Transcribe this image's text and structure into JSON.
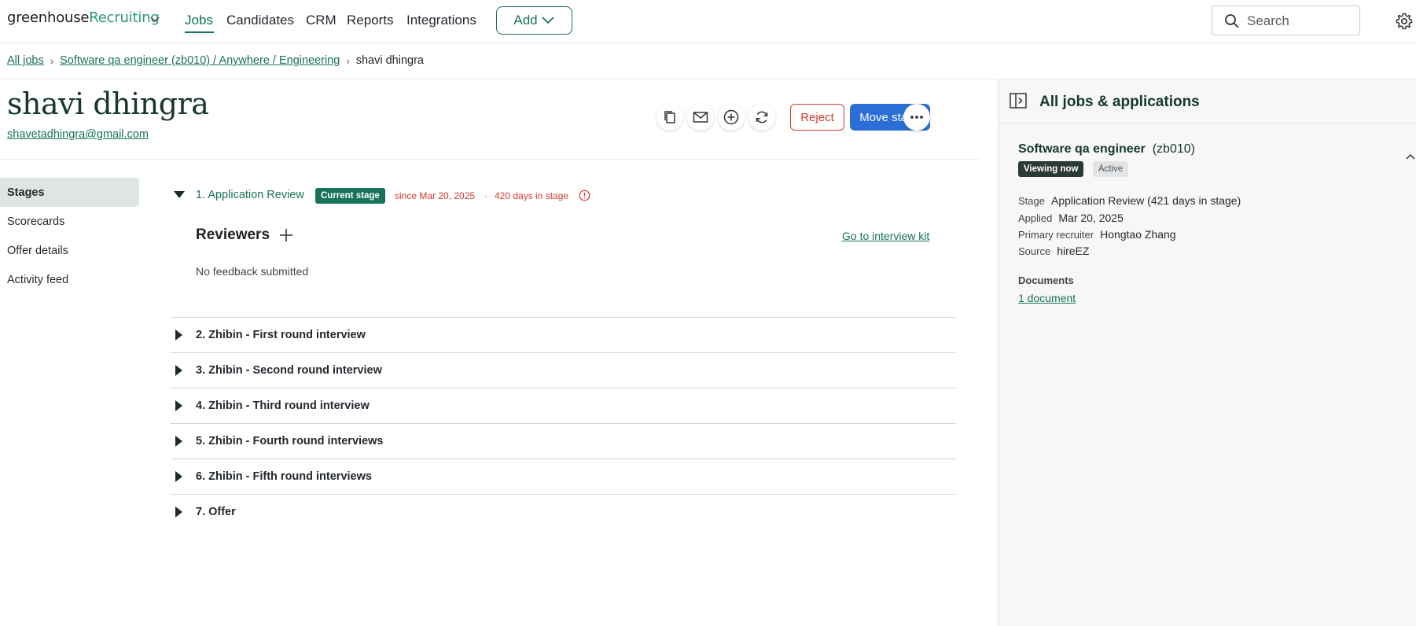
{
  "brand": {
    "name_part1": "greenhouse",
    "name_part2": "Recruiting"
  },
  "nav": {
    "items": [
      {
        "label": "Jobs",
        "active": true
      },
      {
        "label": "Candidates"
      },
      {
        "label": "CRM"
      },
      {
        "label": "Reports"
      },
      {
        "label": "Integrations"
      }
    ],
    "add_label": "Add",
    "search_placeholder": "Search"
  },
  "breadcrumb": {
    "all_jobs": "All jobs",
    "job": "Software qa engineer (zb010) / Anywhere / Engineering",
    "current": "shavi dhingra"
  },
  "candidate": {
    "name": "shavi dhingra",
    "email": "shavetadhingra@gmail.com"
  },
  "actions": {
    "reject": "Reject",
    "move_stage": "Move stage"
  },
  "tabs": [
    {
      "label": "Stages",
      "active": true
    },
    {
      "label": "Scorecards"
    },
    {
      "label": "Offer details"
    },
    {
      "label": "Activity feed"
    }
  ],
  "stage_current": {
    "title": "1. Application Review",
    "badge": "Current stage",
    "since": "since Mar 20, 2025",
    "sep": "·",
    "days": "420 days in stage",
    "reviewers_label": "Reviewers",
    "kit_link": "Go to interview kit",
    "no_feedback": "No feedback submitted"
  },
  "stages": [
    {
      "label": "2. Zhibin - First round interview"
    },
    {
      "label": "3. Zhibin - Second round interview"
    },
    {
      "label": "4. Zhibin - Third round interview"
    },
    {
      "label": "5. Zhibin - Fourth round interviews"
    },
    {
      "label": "6. Zhibin - Fifth round interviews"
    },
    {
      "label": "7. Offer"
    }
  ],
  "panel": {
    "title": "All jobs & applications",
    "job_name": "Software qa engineer",
    "job_code": "(zb010)",
    "badge_viewing": "Viewing now",
    "badge_status": "Active",
    "details": [
      {
        "key": "Stage",
        "value": "Application Review (421 days in stage)"
      },
      {
        "key": "Applied",
        "value": "Mar 20, 2025"
      },
      {
        "key": "Primary recruiter",
        "value": "Hongtao Zhang"
      },
      {
        "key": "Source",
        "value": "hireEZ"
      }
    ],
    "documents_label": "Documents",
    "documents_link": "1 document"
  },
  "colors": {
    "brand_green": "#17725a",
    "primary_blue": "#2b6fd6",
    "danger_red": "#d33a2c"
  }
}
